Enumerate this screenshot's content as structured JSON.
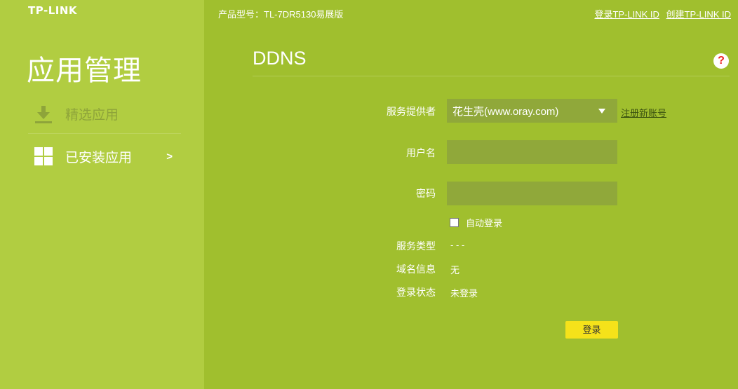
{
  "brand": {
    "logo": "TP-LINK"
  },
  "sidebar": {
    "title": "应用管理",
    "items": [
      {
        "label": "精选应用",
        "icon": "download-icon"
      },
      {
        "label": "已安装应用",
        "icon": "grid-icon",
        "chevron": ">"
      }
    ]
  },
  "header": {
    "model": "产品型号：TL-7DR5130易展版",
    "login_link": "登录TP-LINK ID",
    "create_link": "创建TP-LINK ID"
  },
  "main": {
    "title": "DDNS",
    "help": "?",
    "form": {
      "provider_label": "服务提供者",
      "provider_value": "花生壳(www.oray.com)",
      "register_link": "注册新账号",
      "username_label": "用户名",
      "username_value": "",
      "password_label": "密码",
      "password_value": "",
      "auto_login_label": "自动登录",
      "auto_login_checked": false,
      "service_type_label": "服务类型",
      "service_type_value": "- - -",
      "domain_info_label": "域名信息",
      "domain_info_value": "无",
      "login_status_label": "登录状态",
      "login_status_value": "未登录",
      "login_button": "登录"
    }
  },
  "colors": {
    "sidebar_bg": "#b1cd41",
    "main_bg": "#a0bf2e",
    "field_bg": "#90a83a",
    "button_bg": "#f5e21a"
  }
}
